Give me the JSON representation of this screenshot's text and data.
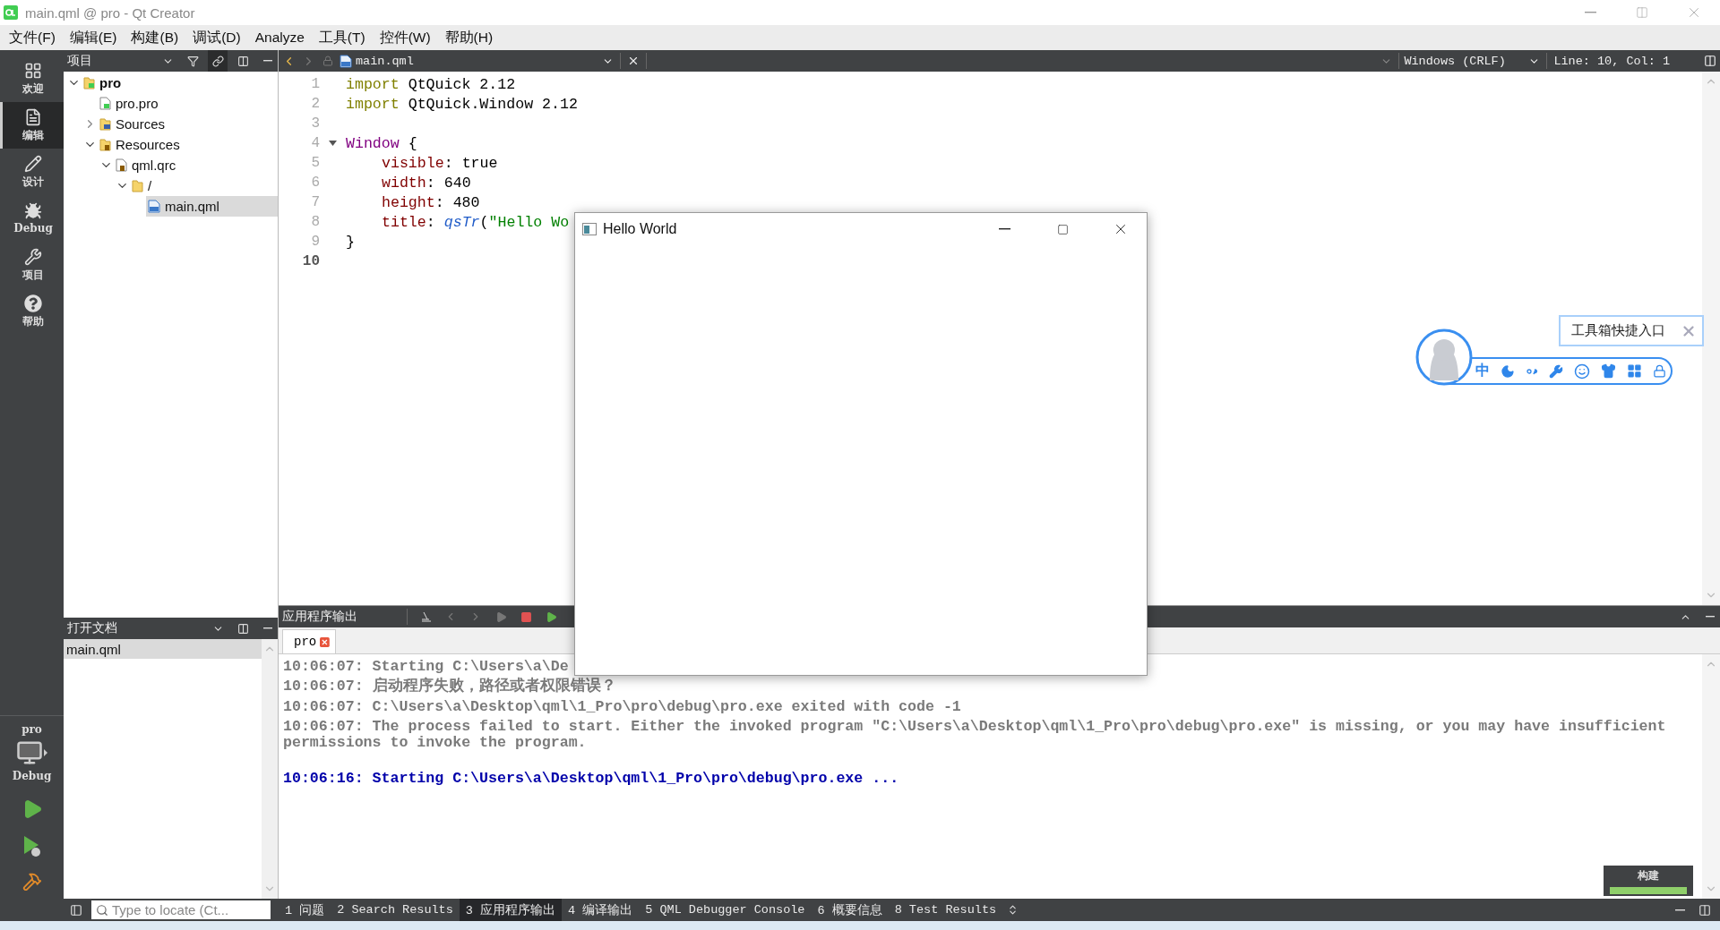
{
  "title_bar": {
    "title": "main.qml @ pro - Qt Creator"
  },
  "menu": [
    "文件(F)",
    "编辑(E)",
    "构建(B)",
    "调试(D)",
    "Analyze",
    "工具(T)",
    "控件(W)",
    "帮助(H)"
  ],
  "mode_bar": {
    "modes": [
      {
        "label": "欢迎",
        "selected": false
      },
      {
        "label": "编辑",
        "selected": true
      },
      {
        "label": "设计",
        "selected": false
      },
      {
        "label": "Debug",
        "selected": false
      },
      {
        "label": "项目",
        "selected": false
      },
      {
        "label": "帮助",
        "selected": false
      }
    ],
    "kit": {
      "project": "pro",
      "config": "Debug"
    }
  },
  "project_pane": {
    "title": "项目",
    "tree": [
      {
        "label": "pro",
        "kind": "project",
        "expanded": true,
        "selected": false,
        "children": [
          {
            "label": "pro.pro",
            "kind": "pro-file",
            "selected": false
          },
          {
            "label": "Sources",
            "kind": "sources",
            "expanded": false,
            "selected": false
          },
          {
            "label": "Resources",
            "kind": "resources",
            "expanded": true,
            "selected": false,
            "children": [
              {
                "label": "qml.qrc",
                "kind": "qrc",
                "expanded": true,
                "selected": false,
                "children": [
                  {
                    "label": "/",
                    "kind": "folder",
                    "expanded": true,
                    "selected": false,
                    "children": [
                      {
                        "label": "main.qml",
                        "kind": "qml",
                        "selected": true
                      }
                    ]
                  }
                ]
              }
            ]
          }
        ]
      }
    ]
  },
  "open_documents": {
    "title": "打开文档",
    "items": [
      {
        "label": "main.qml",
        "selected": true
      }
    ]
  },
  "editor": {
    "file": "main.qml",
    "line_ending": "Windows (CRLF)",
    "position": "Line: 10, Col: 1",
    "lines": [
      {
        "number": "1",
        "current": false,
        "fold": false,
        "indented": false,
        "tokens": [
          {
            "kind": "keyword",
            "text": "import"
          },
          {
            "kind": "plain",
            "text": " QtQuick 2.12"
          }
        ]
      },
      {
        "number": "2",
        "current": false,
        "fold": false,
        "indented": false,
        "tokens": [
          {
            "kind": "keyword",
            "text": "import"
          },
          {
            "kind": "plain",
            "text": " QtQuick.Window 2.12"
          }
        ]
      },
      {
        "number": "3",
        "current": false,
        "fold": false
      },
      {
        "number": "4",
        "current": false,
        "fold": true,
        "indented": false,
        "tokens": [
          {
            "kind": "type",
            "text": "Window"
          },
          {
            "kind": "plain",
            "text": " {"
          }
        ]
      },
      {
        "number": "5",
        "current": false,
        "fold": false,
        "indented": true,
        "tokens": [
          {
            "kind": "property",
            "text": "visible"
          },
          {
            "kind": "plain",
            "text": ": true"
          }
        ]
      },
      {
        "number": "6",
        "current": false,
        "fold": false,
        "indented": true,
        "tokens": [
          {
            "kind": "property",
            "text": "width"
          },
          {
            "kind": "plain",
            "text": ": 640"
          }
        ]
      },
      {
        "number": "7",
        "current": false,
        "fold": false,
        "indented": true,
        "tokens": [
          {
            "kind": "property",
            "text": "height"
          },
          {
            "kind": "plain",
            "text": ": 480"
          }
        ]
      },
      {
        "number": "8",
        "current": false,
        "fold": false,
        "indented": true,
        "tokens": [
          {
            "kind": "property",
            "text": "title"
          },
          {
            "kind": "plain",
            "text": ": "
          },
          {
            "kind": "function",
            "text": "qsTr"
          },
          {
            "kind": "plain",
            "text": "("
          },
          {
            "kind": "string",
            "text": "\"Hello Wo"
          }
        ]
      },
      {
        "number": "9",
        "current": false,
        "fold": false,
        "indented": false,
        "tokens": [
          {
            "kind": "plain",
            "text": "}"
          }
        ]
      },
      {
        "number": "10",
        "current": true,
        "fold": false
      }
    ]
  },
  "output": {
    "title": "应用程序输出",
    "tabs": [
      {
        "label": "pro",
        "selected": true
      }
    ],
    "lines": [
      {
        "kind": "normal",
        "text": "10:06:07: Starting C:\\Users\\a\\De"
      },
      {
        "kind": "normal",
        "text": "10:06:07: 启动程序失败，路径或者权限错误？"
      },
      {
        "kind": "normal",
        "text": "10:06:07: C:\\Users\\a\\Desktop\\qml\\1_Pro\\pro\\debug\\pro.exe exited with code -1"
      },
      {
        "kind": "normal",
        "text": "10:06:07: The process failed to start. Either the invoked program \"C:\\Users\\a\\Desktop\\qml\\1_Pro\\pro\\debug\\pro.exe\" is missing, or you may have insufficient permissions to invoke the program."
      },
      {
        "kind": "start",
        "text": "10:06:16: Starting C:\\Users\\a\\Desktop\\qml\\1_Pro\\pro\\debug\\pro.exe ..."
      }
    ]
  },
  "status_bar": {
    "locate_placeholder": "Type to locate (Ct...",
    "tabs": [
      {
        "label": "1 问题",
        "selected": false
      },
      {
        "label": "2 Search Results",
        "selected": false
      },
      {
        "label": "3 应用程序输出",
        "selected": true
      },
      {
        "label": "4 编译输出",
        "selected": false
      },
      {
        "label": "5 QML Debugger Console",
        "selected": false
      },
      {
        "label": "6 概要信息",
        "selected": false
      },
      {
        "label": "8 Test Results",
        "selected": false
      }
    ]
  },
  "build_progress": {
    "label": "构建",
    "level": 1
  },
  "popup_window": {
    "title": "Hello World"
  },
  "toolbox": {
    "tip": "工具箱快捷入口",
    "language": "中"
  }
}
